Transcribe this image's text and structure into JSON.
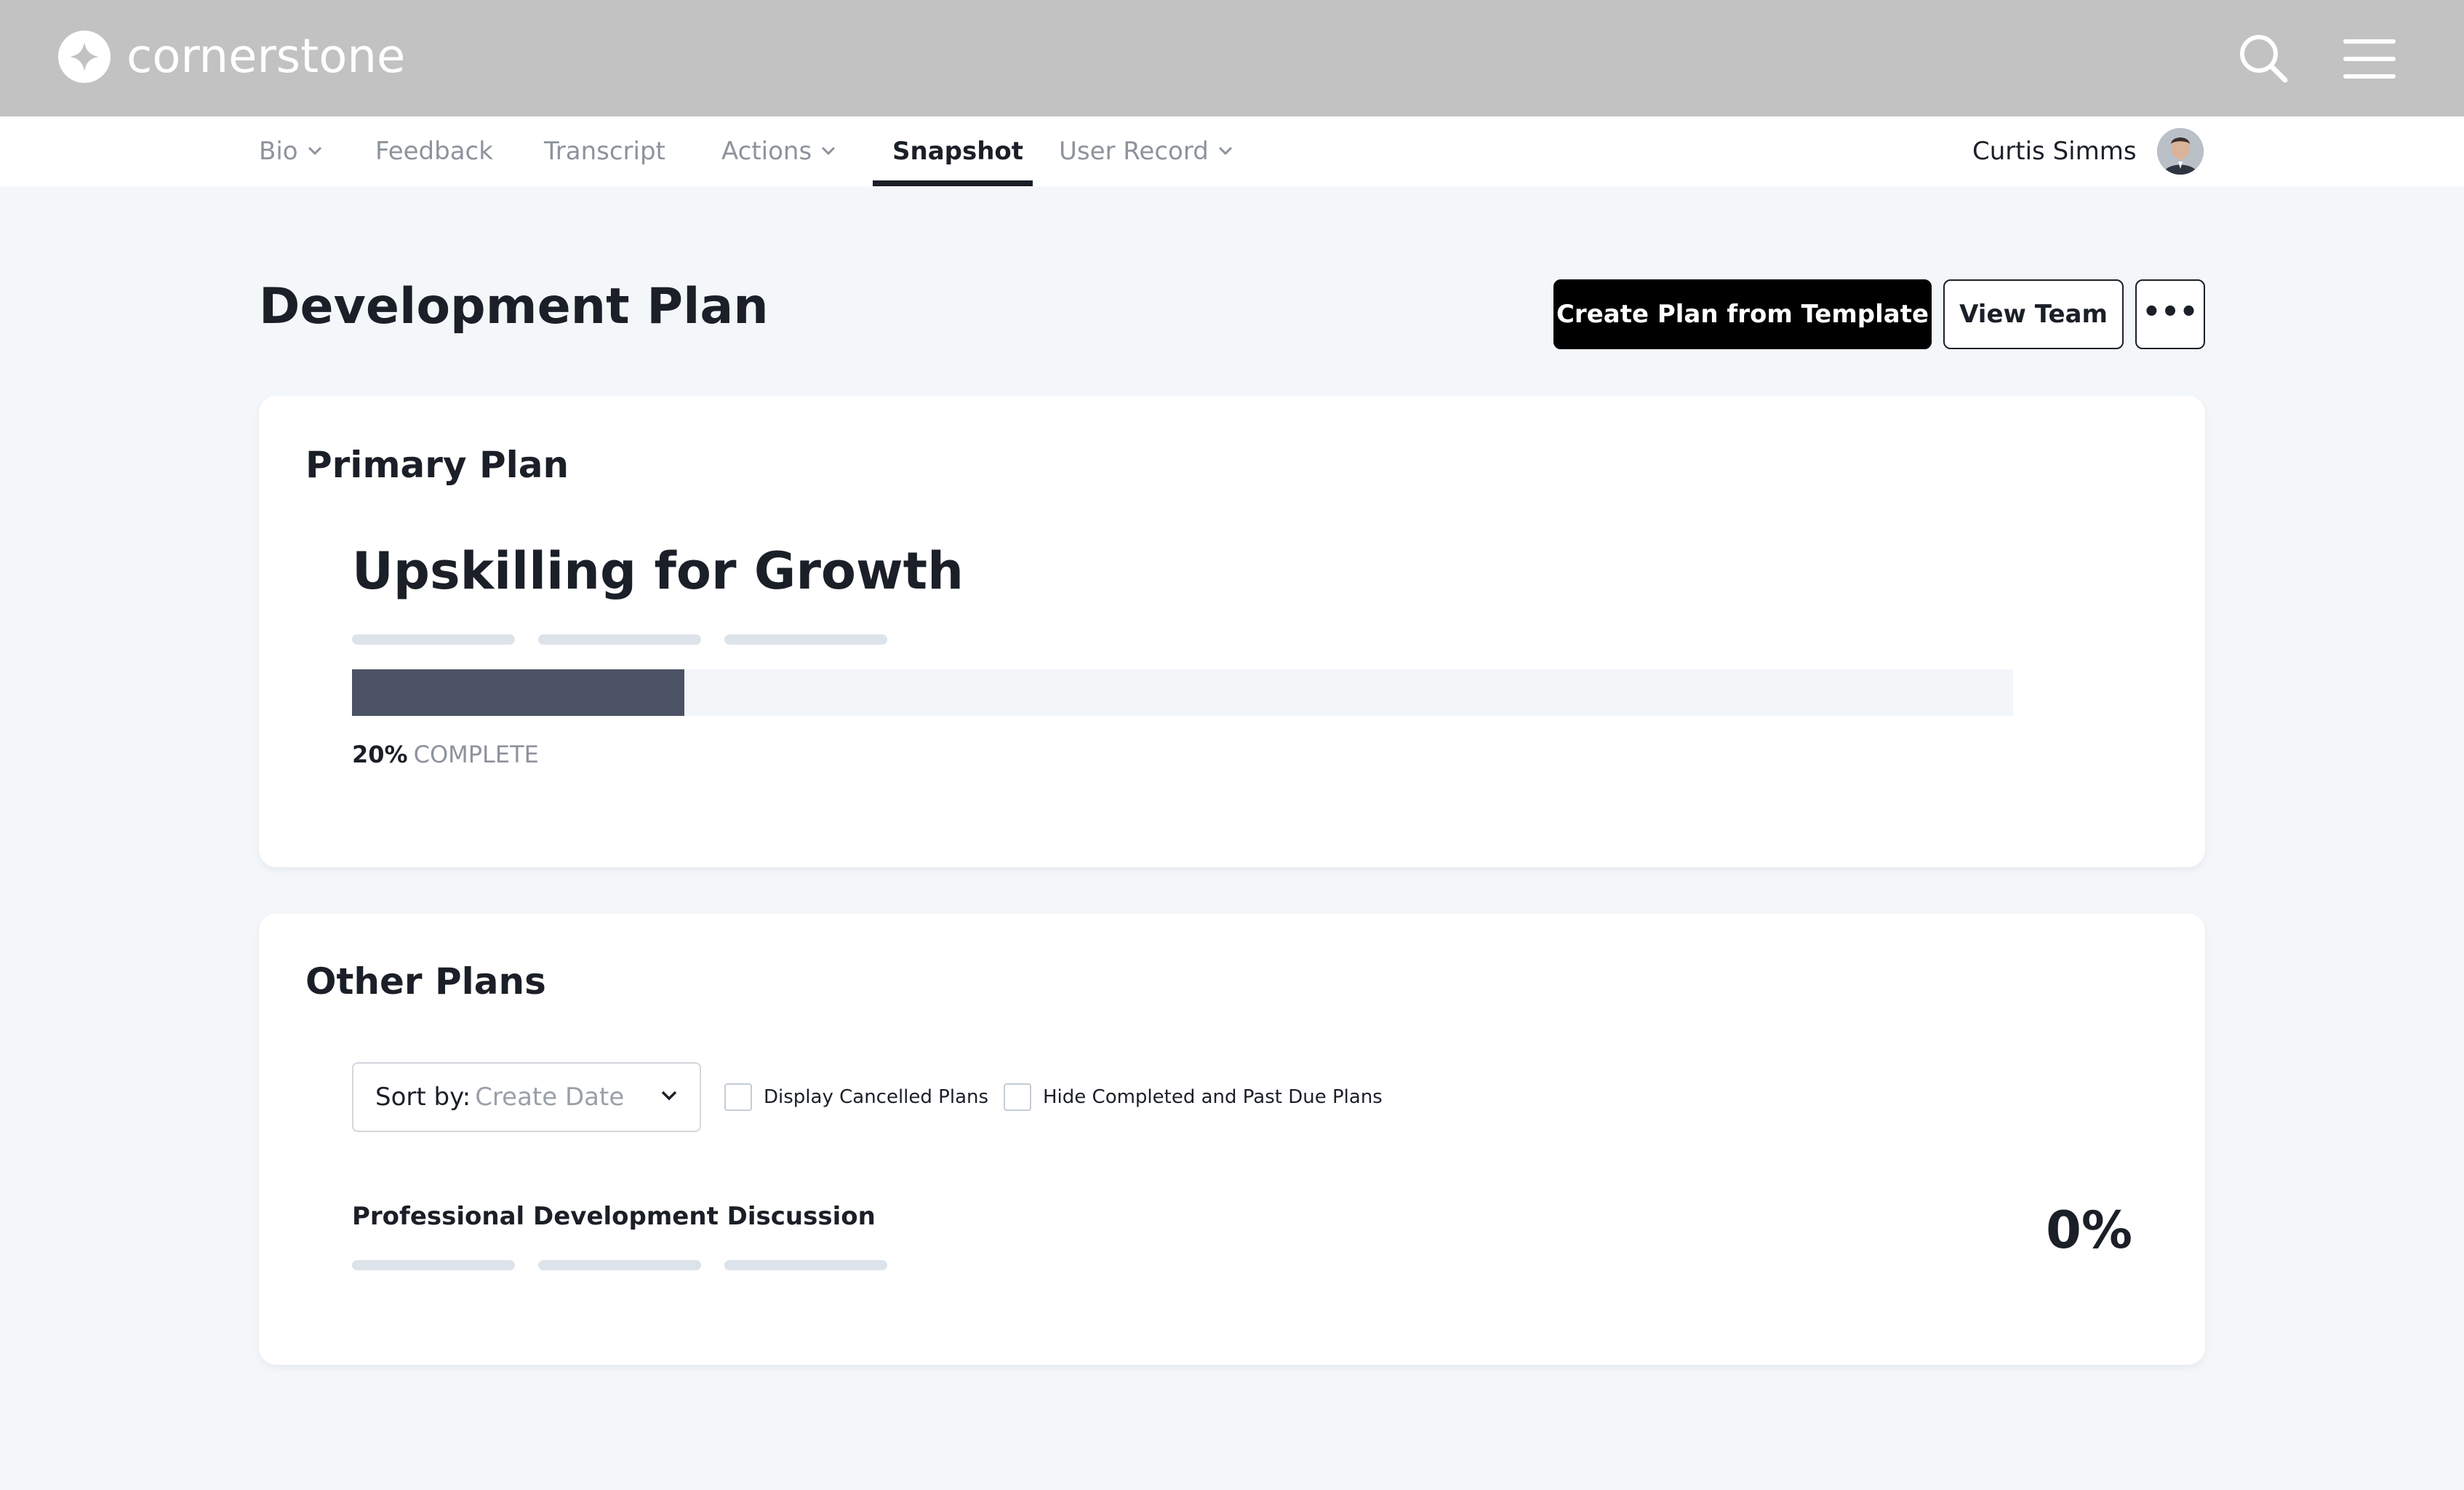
{
  "header": {
    "brand": "cornerstone",
    "search_icon": "search-icon",
    "menu_icon": "hamburger-menu-icon"
  },
  "nav": {
    "tabs": [
      {
        "label": "Bio",
        "has_dropdown": true
      },
      {
        "label": "Feedback",
        "has_dropdown": false
      },
      {
        "label": "Transcript",
        "has_dropdown": false
      },
      {
        "label": "Actions",
        "has_dropdown": true
      },
      {
        "label": "Snapshot",
        "has_dropdown": false,
        "active": true
      },
      {
        "label": "User Record",
        "has_dropdown": true
      }
    ],
    "user_name": "Curtis Simms"
  },
  "page": {
    "title": "Development Plan",
    "buttons": {
      "create_plan": "Create Plan from Template",
      "view_team": "View Team",
      "more": "•••"
    }
  },
  "primary_plan": {
    "section_title": "Primary Plan",
    "plan_name": "Upskilling for Growth",
    "progress_percent": 20,
    "progress_text": "20%",
    "progress_word": "COMPLETE"
  },
  "other_plans": {
    "section_title": "Other Plans",
    "sort": {
      "label": "Sort by:",
      "value": "Create Date"
    },
    "filters": {
      "display_cancelled": {
        "label": "Display Cancelled Plans",
        "checked": false
      },
      "hide_completed": {
        "label": "Hide Completed and Past Due Plans",
        "checked": false
      }
    },
    "plans": [
      {
        "name": "Professional Development Discussion",
        "percent": "0%"
      }
    ]
  },
  "colors": {
    "header_bg": "#c2c2c2",
    "page_bg": "#f4f7fa",
    "progress_fill": "#4a5263",
    "primary_button": "#000000"
  }
}
